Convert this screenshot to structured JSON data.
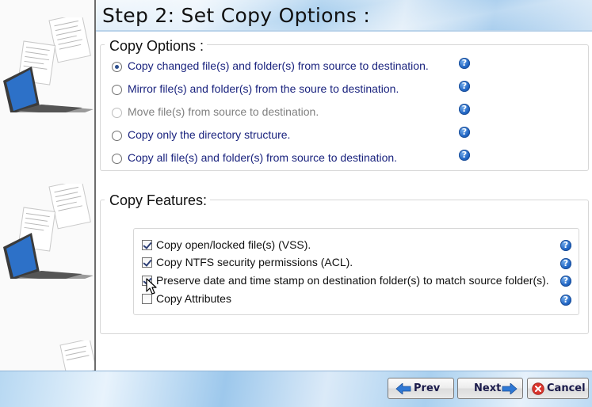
{
  "header": {
    "title": "Step 2: Set Copy Options :"
  },
  "copy_options": {
    "title": "Copy Options :",
    "options": [
      {
        "label": "Copy changed file(s) and folder(s) from source to destination.",
        "selected": true,
        "enabled": true
      },
      {
        "label": "Mirror file(s) and folder(s) from the soure to destination.",
        "selected": false,
        "enabled": true
      },
      {
        "label": "Move file(s) from source to destination.",
        "selected": false,
        "enabled": false
      },
      {
        "label": "Copy only the directory structure.",
        "selected": false,
        "enabled": true
      },
      {
        "label": "Copy all file(s) and folder(s) from source to destination.",
        "selected": false,
        "enabled": true
      }
    ]
  },
  "copy_features": {
    "title": "Copy Features:",
    "features": [
      {
        "label": "Copy open/locked file(s) (VSS).",
        "checked": true
      },
      {
        "label": "Copy NTFS security permissions (ACL).",
        "checked": true
      },
      {
        "label": "Preserve date and time stamp on destination folder(s) to match source folder(s).",
        "checked": true
      },
      {
        "label": "Copy Attributes",
        "checked": false
      }
    ]
  },
  "help_icon_glyph": "?",
  "footer": {
    "prev_label": "Prev",
    "next_label": "Next",
    "cancel_label": "Cancel"
  },
  "colors": {
    "accent_blue": "#2166c4",
    "option_text": "#1a237e",
    "disabled_text": "#808080",
    "cancel_red": "#d9342b",
    "arrow_blue": "#2f78d4"
  }
}
